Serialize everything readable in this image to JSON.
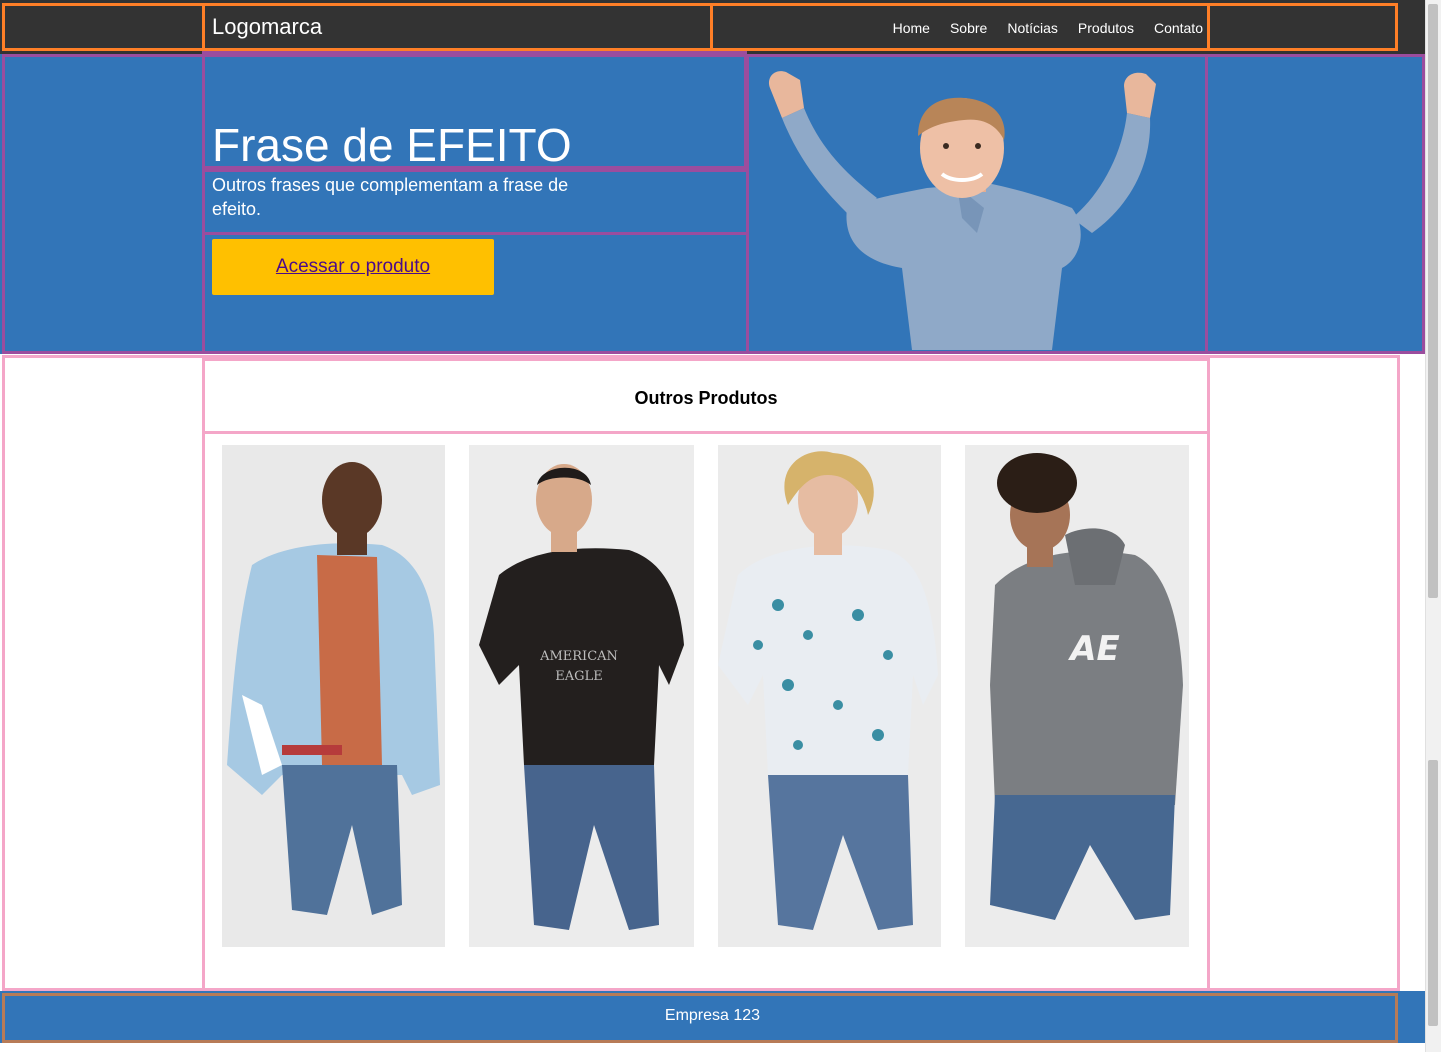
{
  "header": {
    "logo": "Logomarca",
    "nav": [
      "Home",
      "Sobre",
      "Notícias",
      "Produtos",
      "Contato"
    ]
  },
  "hero": {
    "title": "Frase de EFEITO",
    "subtitle": "Outros frases que complementam a frase de efeito.",
    "cta_label": "Acessar o produto"
  },
  "products": {
    "title": "Outros Produtos",
    "items": [
      {
        "shirt": "light-blue bomber jacket over orange tee",
        "shirt_color": "#a6c9e3"
      },
      {
        "shirt": "black tee with \"AMERICAN EAGLE\" print",
        "shirt_color": "#231f1e",
        "print": "AMERICAN EAGLE"
      },
      {
        "shirt": "white tropical print shirt",
        "shirt_color": "#e9edf2"
      },
      {
        "shirt": "grey hoodie with \"AE\" print",
        "shirt_color": "#7b7e82",
        "print": "AE"
      }
    ]
  },
  "footer": {
    "text": "Empresa 123"
  },
  "colors": {
    "header_bg": "#333333",
    "hero_bg": "#3275b8",
    "cta_bg": "#ffc000",
    "footer_bg": "#3275b8",
    "outline_header": "#ff7f27",
    "outline_hero": "#9b4d9e",
    "outline_products": "#f4a6c8",
    "outline_footer": "#b77b57"
  }
}
